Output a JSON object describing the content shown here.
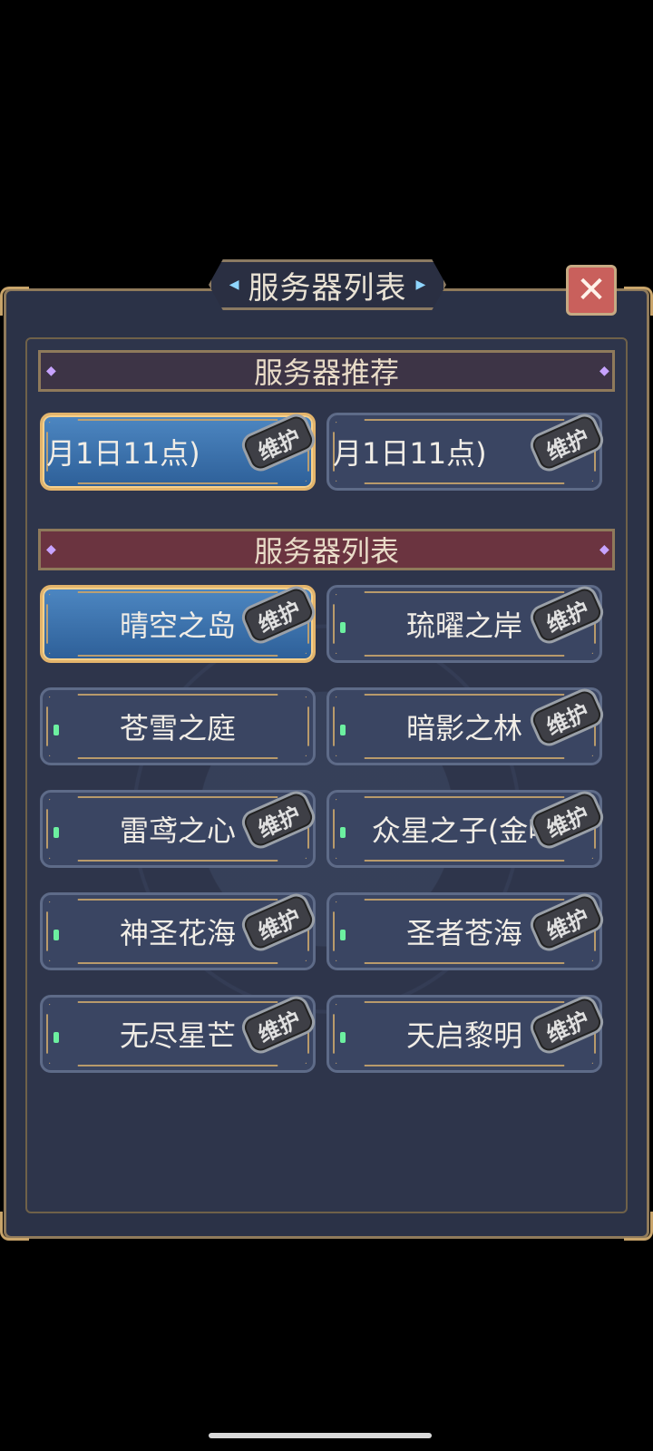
{
  "title": "服务器列表",
  "recommend_header": "服务器推荐",
  "list_header": "服务器列表",
  "badge_label": "维护",
  "recommended": [
    {
      "name": "月1日11点)"
    },
    {
      "name": "月1日11点)"
    }
  ],
  "servers": [
    {
      "name": "晴空之岛"
    },
    {
      "name": "琉曜之岸"
    },
    {
      "name": "苍雪之庭"
    },
    {
      "name": "暗影之林"
    },
    {
      "name": "雷鸢之心"
    },
    {
      "name": "众星之子(金叶"
    },
    {
      "name": "神圣花海"
    },
    {
      "name": "圣者苍海"
    },
    {
      "name": "无尽星芒"
    },
    {
      "name": "天启黎明"
    }
  ],
  "colors": {
    "panel_bg": "#2b3247",
    "gold_border": "#c8a46a",
    "selected_blue": "#3f77b3",
    "list_header_red": "#6b3440",
    "online_green": "#6cf0a0",
    "close_red": "#c9605c"
  },
  "icons": {
    "close": "close-icon",
    "status": "online-status-dot"
  }
}
